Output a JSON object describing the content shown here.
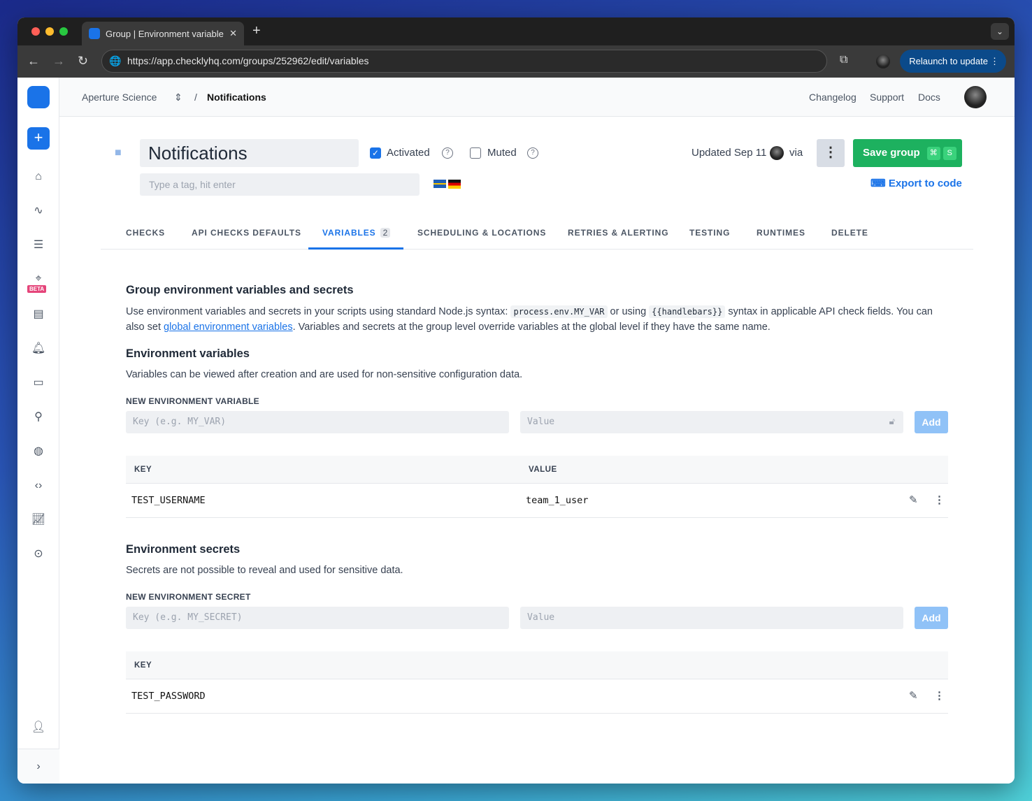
{
  "browser": {
    "tab_title": "Group | Environment variables",
    "url": "https://app.checklyhq.com/groups/252962/edit/variables",
    "relaunch_label": "Relaunch to update"
  },
  "sidebar": {
    "beta_label": "BETA"
  },
  "topnav": {
    "org": "Aperture Science",
    "separator": "/",
    "page": "Notifications",
    "links": [
      "Changelog",
      "Support",
      "Docs"
    ]
  },
  "header": {
    "title": "Notifications",
    "tag_placeholder": "Type a tag, hit enter",
    "activated_label": "Activated",
    "activated": true,
    "muted_label": "Muted",
    "muted": false,
    "updated_text": "Updated Sep 11",
    "via": "via",
    "save_label": "Save group",
    "save_kbd": [
      "⌘",
      "S"
    ],
    "export_label": "Export to code"
  },
  "tabs": [
    {
      "label": "CHECKS"
    },
    {
      "label": "API CHECKS DEFAULTS"
    },
    {
      "label": "VARIABLES",
      "badge": "2",
      "active": true
    },
    {
      "label": "SCHEDULING & LOCATIONS"
    },
    {
      "label": "RETRIES & ALERTING"
    },
    {
      "label": "TESTING"
    },
    {
      "label": "RUNTIMES"
    },
    {
      "label": "DELETE"
    }
  ],
  "section": {
    "title": "Group environment variables and secrets",
    "p1": "Use environment variables and secrets in your scripts using standard Node.js syntax:",
    "code1": "process.env.MY_VAR",
    "p2": "or using",
    "code2": "{{handlebars}}",
    "p3": "syntax in applicable API check fields. You can also set",
    "link": "global environment variables",
    "p4": ". Variables and secrets at the group level override variables at the global level if they have the same name."
  },
  "env_vars": {
    "title": "Environment variables",
    "desc": "Variables can be viewed after creation and are used for non-sensitive configuration data.",
    "new_label": "NEW ENVIRONMENT VARIABLE",
    "key_placeholder": "Key (e.g. MY_VAR)",
    "value_placeholder": "Value",
    "add_label": "Add",
    "col_key": "KEY",
    "col_value": "VALUE",
    "rows": [
      {
        "key": "TEST_USERNAME",
        "value": "team_1_user"
      }
    ]
  },
  "secrets": {
    "title": "Environment secrets",
    "desc": "Secrets are not possible to reveal and used for sensitive data.",
    "new_label": "NEW ENVIRONMENT SECRET",
    "key_placeholder": "Key (e.g. MY_SECRET)",
    "value_placeholder": "Value",
    "add_label": "Add",
    "col_key": "KEY",
    "rows": [
      {
        "key": "TEST_PASSWORD"
      }
    ]
  }
}
